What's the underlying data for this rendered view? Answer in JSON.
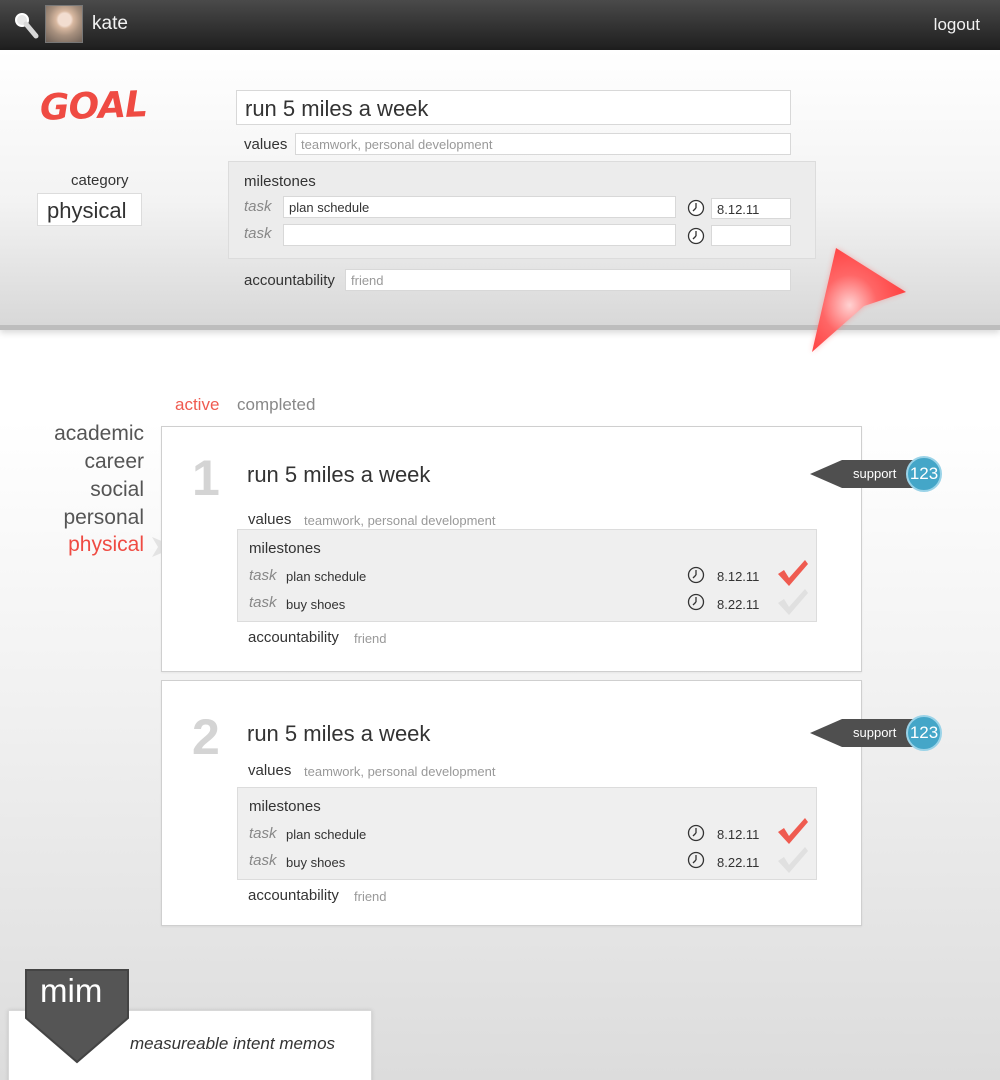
{
  "topbar": {
    "username": "kate",
    "logout_label": "logout"
  },
  "editor": {
    "heading": "GOAL",
    "category_label": "category",
    "category_value": "physical",
    "goal_title": "run 5 miles a week",
    "values_label": "values",
    "values_placeholder": "teamwork, personal development",
    "milestones_label": "milestones",
    "tasks": [
      {
        "label": "task",
        "value": "plan schedule",
        "date": "8.12.11"
      },
      {
        "label": "task",
        "value": "",
        "date": ""
      }
    ],
    "accountability_label": "accountability",
    "accountability_placeholder": "friend"
  },
  "tabs": {
    "active": "active",
    "completed": "completed"
  },
  "categories": [
    {
      "label": "academic",
      "selected": false
    },
    {
      "label": "career",
      "selected": false
    },
    {
      "label": "social",
      "selected": false
    },
    {
      "label": "personal",
      "selected": false
    },
    {
      "label": "physical",
      "selected": true
    }
  ],
  "goals": [
    {
      "number": "1",
      "title": "run 5 miles a week",
      "values_label": "values",
      "values": "teamwork, personal development",
      "milestones_label": "milestones",
      "tasks": [
        {
          "label": "task",
          "name": "plan schedule",
          "date": "8.12.11",
          "done": true
        },
        {
          "label": "task",
          "name": "buy shoes",
          "date": "8.22.11",
          "done": false
        }
      ],
      "accountability_label": "accountability",
      "accountability": "friend",
      "support_label": "support",
      "support_count": "123"
    },
    {
      "number": "2",
      "title": "run 5 miles a week",
      "values_label": "values",
      "values": "teamwork, personal development",
      "milestones_label": "milestones",
      "tasks": [
        {
          "label": "task",
          "name": "plan schedule",
          "date": "8.12.11",
          "done": true
        },
        {
          "label": "task",
          "name": "buy shoes",
          "date": "8.22.11",
          "done": false
        }
      ],
      "accountability_label": "accountability",
      "accountability": "friend",
      "support_label": "support",
      "support_count": "123"
    }
  ],
  "footer": {
    "logo": "mim",
    "tagline": "measureable intent memos"
  },
  "colors": {
    "accent": "#ef4b43",
    "support_badge": "#44a6c8",
    "done_check": "#ef5b50",
    "pending_check": "#e0e0e0"
  }
}
